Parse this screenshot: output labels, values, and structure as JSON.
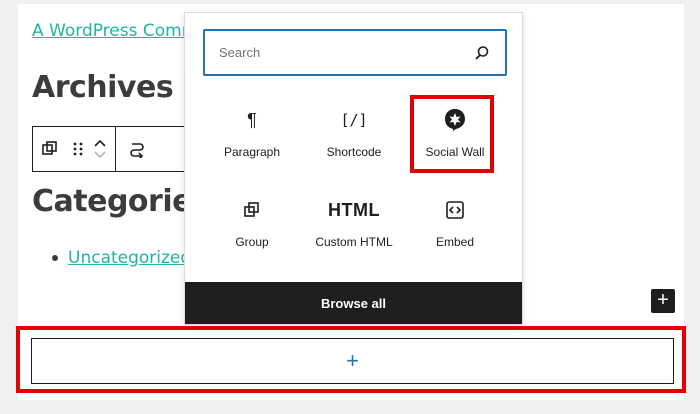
{
  "page": {
    "comment_link": "A WordPress Comm",
    "archives_heading": "Archives",
    "categories_heading": "Categories",
    "category_item": "Uncategorized"
  },
  "toolbar": {
    "icons": [
      "block-type-icon",
      "drag-handle-icon",
      "move-up-icon",
      "move-down-icon",
      "transform-icon"
    ]
  },
  "inserter": {
    "search_placeholder": "Search",
    "blocks": [
      {
        "label": "Paragraph",
        "icon": "paragraph-icon"
      },
      {
        "label": "Shortcode",
        "icon": "shortcode-icon"
      },
      {
        "label": "Social Wall",
        "icon": "social-wall-icon"
      },
      {
        "label": "Group",
        "icon": "group-icon"
      },
      {
        "label": "Custom HTML",
        "icon": "html-icon"
      },
      {
        "label": "Embed",
        "icon": "embed-icon"
      }
    ],
    "html_icon_text": "HTML",
    "shortcode_icon_text": "[/]",
    "browse_all": "Browse all"
  },
  "appender": {
    "symbol": "+"
  },
  "small_inserter": {
    "symbol": "+"
  },
  "colors": {
    "highlight": "#e40000",
    "link": "#1fb5a0",
    "accent": "#2271b1",
    "dark": "#1e1e1e"
  }
}
